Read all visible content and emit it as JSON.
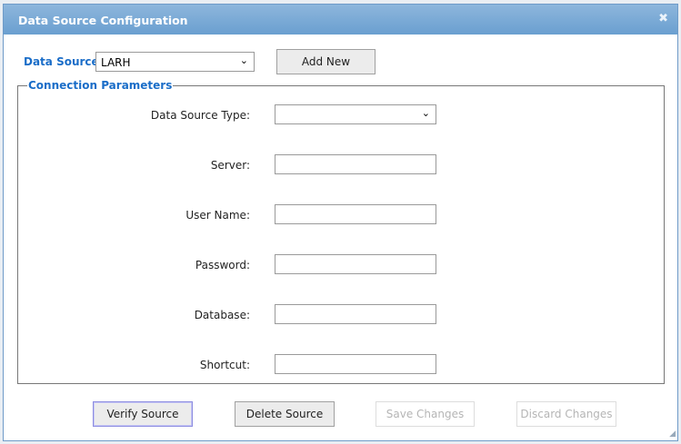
{
  "dialog": {
    "title": "Data Source Configuration",
    "close_icon": "close-x-icon"
  },
  "data_source": {
    "label": "Data Source:",
    "value": "LARH",
    "add_new": "Add New"
  },
  "connection": {
    "legend": "Connection Parameters",
    "fields": [
      {
        "label": "Data Source Type:",
        "value": ""
      },
      {
        "label": "Server:",
        "value": ""
      },
      {
        "label": "User Name:",
        "value": ""
      },
      {
        "label": "Password:",
        "value": ""
      },
      {
        "label": "Database:",
        "value": ""
      },
      {
        "label": "Shortcut:",
        "value": ""
      }
    ]
  },
  "buttons": {
    "verify": "Verify Source",
    "delete": "Delete Source",
    "save": "Save Changes",
    "discard": "Discard Changes"
  }
}
